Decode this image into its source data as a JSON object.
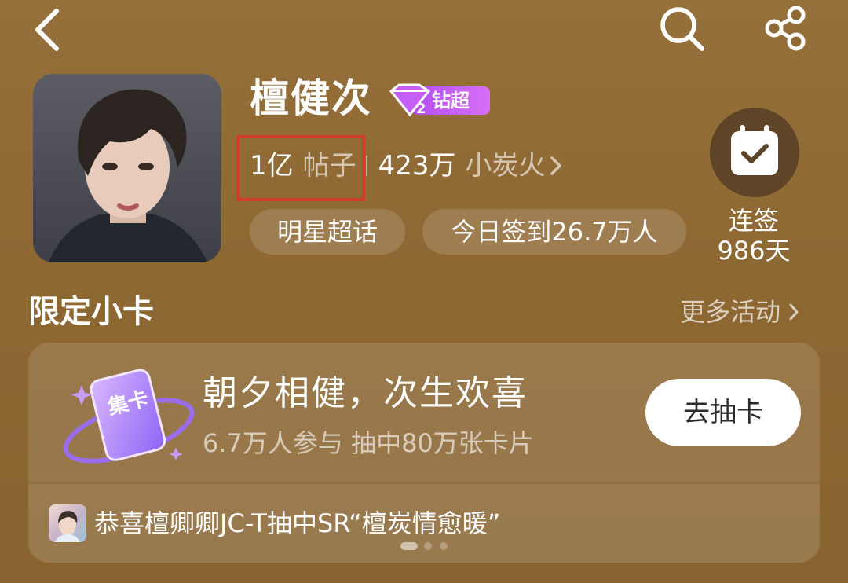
{
  "header": {
    "back_icon": "chevron-left-icon",
    "search_icon": "search-icon",
    "share_icon": "share-icon"
  },
  "topic": {
    "name": "檀健次",
    "tier_badge": "钻超",
    "tier_level": "2",
    "posts_count": "1亿",
    "posts_label": "帖子",
    "fans_count": "423万",
    "fans_label": "小炭火",
    "category_chip": "明星超话",
    "checkin_today": "今日签到26.7万人",
    "streak_label": "连签",
    "streak_days": "986天"
  },
  "section": {
    "title": "限定小卡",
    "more_label": "更多活动"
  },
  "card_event": {
    "icon_text": "集卡",
    "title": "朝夕相健，次生欢喜",
    "subtitle": "6.7万人参与 抽中80万张卡片",
    "button_label": "去抽卡",
    "announcement": "恭喜檀卿卿JC-T抽中SR“檀炭情愈暖”",
    "carousel_pages": 3,
    "carousel_active": 1
  },
  "colors": {
    "background": "#8f6a34",
    "badge_purple": "#c15cf4",
    "highlight_red": "#d33a2c",
    "checkin_button": "#5e4528"
  }
}
